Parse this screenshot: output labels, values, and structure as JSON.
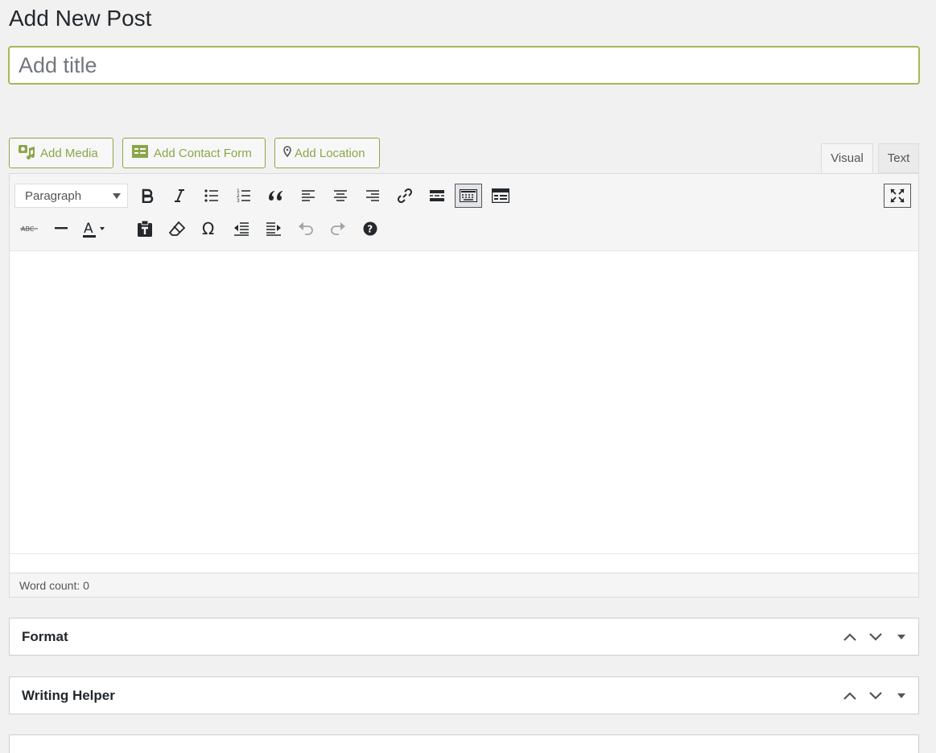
{
  "page": {
    "title": "Add New Post"
  },
  "title_input": {
    "placeholder": "Add title"
  },
  "media_buttons": [
    {
      "label": "Add Media",
      "icon": "media-icon"
    },
    {
      "label": "Add Contact Form",
      "icon": "form-icon"
    },
    {
      "label": "Add Location",
      "icon": "location-pin-icon"
    }
  ],
  "tabs": [
    {
      "label": "Visual",
      "active": true
    },
    {
      "label": "Text",
      "active": false
    }
  ],
  "toolbar": {
    "format_select": "Paragraph",
    "row1": [
      "bold-icon",
      "italic-icon",
      "bullet-list-icon",
      "numbered-list-icon",
      "blockquote-icon",
      "align-left-icon",
      "align-center-icon",
      "align-right-icon",
      "link-icon",
      "read-more-icon",
      "toolbar-toggle-icon",
      "form-icon"
    ],
    "row2": [
      "strikethrough-icon",
      "horizontal-line-icon",
      "text-color-icon",
      "paste-text-icon",
      "clear-formatting-icon",
      "special-character-icon",
      "outdent-icon",
      "indent-icon",
      "undo-icon",
      "redo-icon",
      "help-icon"
    ],
    "strikethrough_text": "ABC",
    "text_color_letter": "A"
  },
  "statusbar": {
    "word_count": "Word count: 0"
  },
  "metaboxes": [
    {
      "title": "Format"
    },
    {
      "title": "Writing Helper"
    },
    {
      "title": ""
    }
  ],
  "colors": {
    "accent": "#8ba64a",
    "title_border": "#a4b958"
  }
}
